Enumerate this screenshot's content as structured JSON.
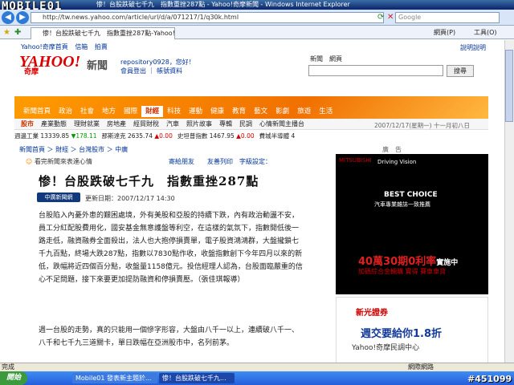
{
  "window": {
    "title": "惨！台股跌破七千九　指數重挫287點 - Yahoo!奇摩新聞 - Windows Internet Explorer",
    "url": "http://tw.news.yahoo.com/article/url/d/a/071217/1/q30k.html",
    "search_placeholder": "Google",
    "tab_label": "惨！台股跌破七千九　指數重挫287點-Yahoo!奇...",
    "tools": [
      "網頁(P)",
      "工具(O)"
    ]
  },
  "watermark": "MOBILE01",
  "page": {
    "toplinks": [
      "Yahoo!奇摩首頁",
      "信箱",
      "拍賣"
    ],
    "help": "說明說明",
    "logo": "YAHOO!",
    "logo_sub": "奇摩",
    "section": "新聞",
    "user": "repository0928，您好！",
    "user_links": "會員登出 ｜ 帳號資料",
    "search_tabs": "新聞　網頁",
    "search_btn": "搜尋",
    "nav": [
      "新聞首頁",
      "政治",
      "社會",
      "地方",
      "國際",
      "財經",
      "科技",
      "運動",
      "健康",
      "教育",
      "藝文",
      "影劇",
      "旅遊",
      "生活"
    ],
    "subnav": [
      "股市",
      "產業動態",
      "理財就業",
      "房地產",
      "經貿財稅",
      "汽車",
      "照片故事",
      "專輯",
      "民調",
      "心情新聞主播台"
    ],
    "date": "2007/12/17(星期一) 十一月初八日",
    "ticker": [
      {
        "label": "週邊工業",
        "value": "13339.85",
        "change": "▼178.11",
        "dir": "up"
      },
      {
        "label": "那斯達克",
        "value": "2635.74",
        "change": "▲0.00",
        "dir": "down"
      },
      {
        "label": "史坦普指數",
        "value": "1467.95",
        "change": "▲0.00",
        "dir": "down"
      },
      {
        "label": "費城半導體",
        "value": "4",
        "change": "",
        "dir": ""
      }
    ],
    "breadcrumb": "新聞首頁 ＞ 財經 ＞ 台灣股市 ＞ 中廣",
    "share": "看完新聞來表達心情",
    "tools_line": "寄給朋友　　友善列印　字級設定：",
    "headline": "惨！台股跌破七千九　指數重挫287點",
    "source": "中廣新聞網",
    "update_time": "更新日期：2007/12/17 14:30",
    "para1": "台股陷入內憂外患的艱困處境，外有美股和亞股的持續下跌，內有政治動盪不安，員工分紅配股費用化，國安基金無意護盤等利空，在這樣的氣氛下，指數開低後一路走低，融資融券全面殺出，法人也大抱停損賣單，電子股資鴻鴻群，大盤攏鎖七千九百點，終場大跌287點，指數以7830點作收，收盤指數創下今年四月以來的新低，跌幅將近四個百分點，收盤量1158億元。投信經理人認為，台股面臨嚴重的信心不足問題，接下來要更加提防融資和停損賣壓。（張佳琪報導）",
    "para2": "週一台股的走勢，真的只能用一個慘字形容，大盤由八千一以上，連續破八千一、八千和七千九三道關卡，單日跌幅在亞洲股市中，名列前茅。",
    "ad_label": "廣　告",
    "ad1": {
      "brand": "MITSUBISHI",
      "tag": "Driving Vision",
      "best": "BEST CHOICE",
      "award": "汽車專業雜誌一致推薦",
      "promo_pre": "40萬",
      "promo_mid": "30期",
      "promo_rate": "0利率",
      "promo_end": "實施中",
      "fine": "加碼綜合金輛購 實得 賽車車貸"
    },
    "ad2": {
      "logo": "新光證券",
      "big": "週交要給你1.8折"
    },
    "market": "Yahoo!奇摩民調中心"
  },
  "status": {
    "left": "完成",
    "right": "網際網路"
  },
  "taskbar": {
    "start": "開始",
    "tasks": [
      "Mobile01 發表新主題於...",
      "惨！台股跌破七千九..."
    ],
    "id": "#451099"
  }
}
